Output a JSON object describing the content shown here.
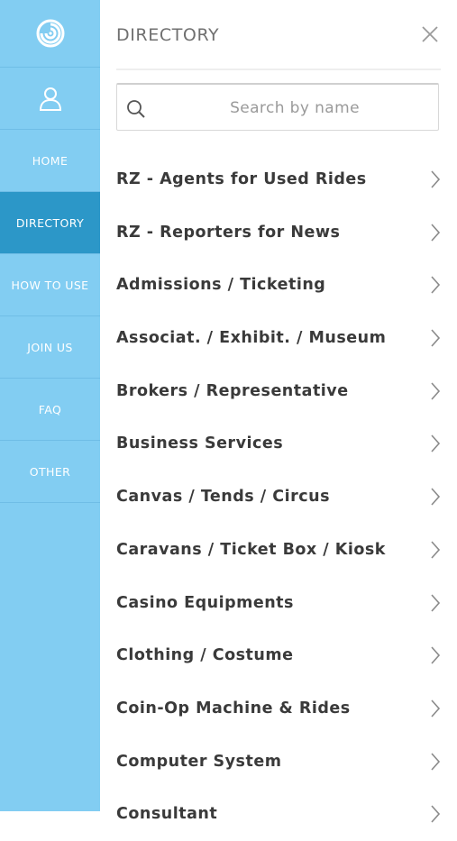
{
  "sidebar": {
    "items": [
      {
        "label": "HOME",
        "active": false
      },
      {
        "label": "DIRECTORY",
        "active": true
      },
      {
        "label": "HOW TO USE",
        "active": false
      },
      {
        "label": "JOIN US",
        "active": false
      },
      {
        "label": "FAQ",
        "active": false
      },
      {
        "label": "OTHER",
        "active": false
      }
    ],
    "logo_icon": "swirl-logo-icon",
    "user_icon": "user-icon"
  },
  "header": {
    "title": "DIRECTORY",
    "close_icon": "close-icon"
  },
  "search": {
    "placeholder": "Search by name",
    "value": "",
    "icon": "search-icon"
  },
  "directory": {
    "items": [
      "RZ - Agents for Used Rides",
      "RZ - Reporters for News",
      "Admissions / Ticketing",
      "Associat. / Exhibit. / Museum",
      "Brokers / Representative",
      "Business Services",
      "Canvas / Tends / Circus",
      "Caravans / Ticket Box / Kiosk",
      "Casino Equipments",
      "Clothing / Costume",
      "Coin-Op Machine & Rides",
      "Computer System",
      "Consultant"
    ]
  },
  "colors": {
    "sidebar_bg": "#82cdf2",
    "sidebar_active": "#2c97c8",
    "text": "#3a3a3a"
  }
}
